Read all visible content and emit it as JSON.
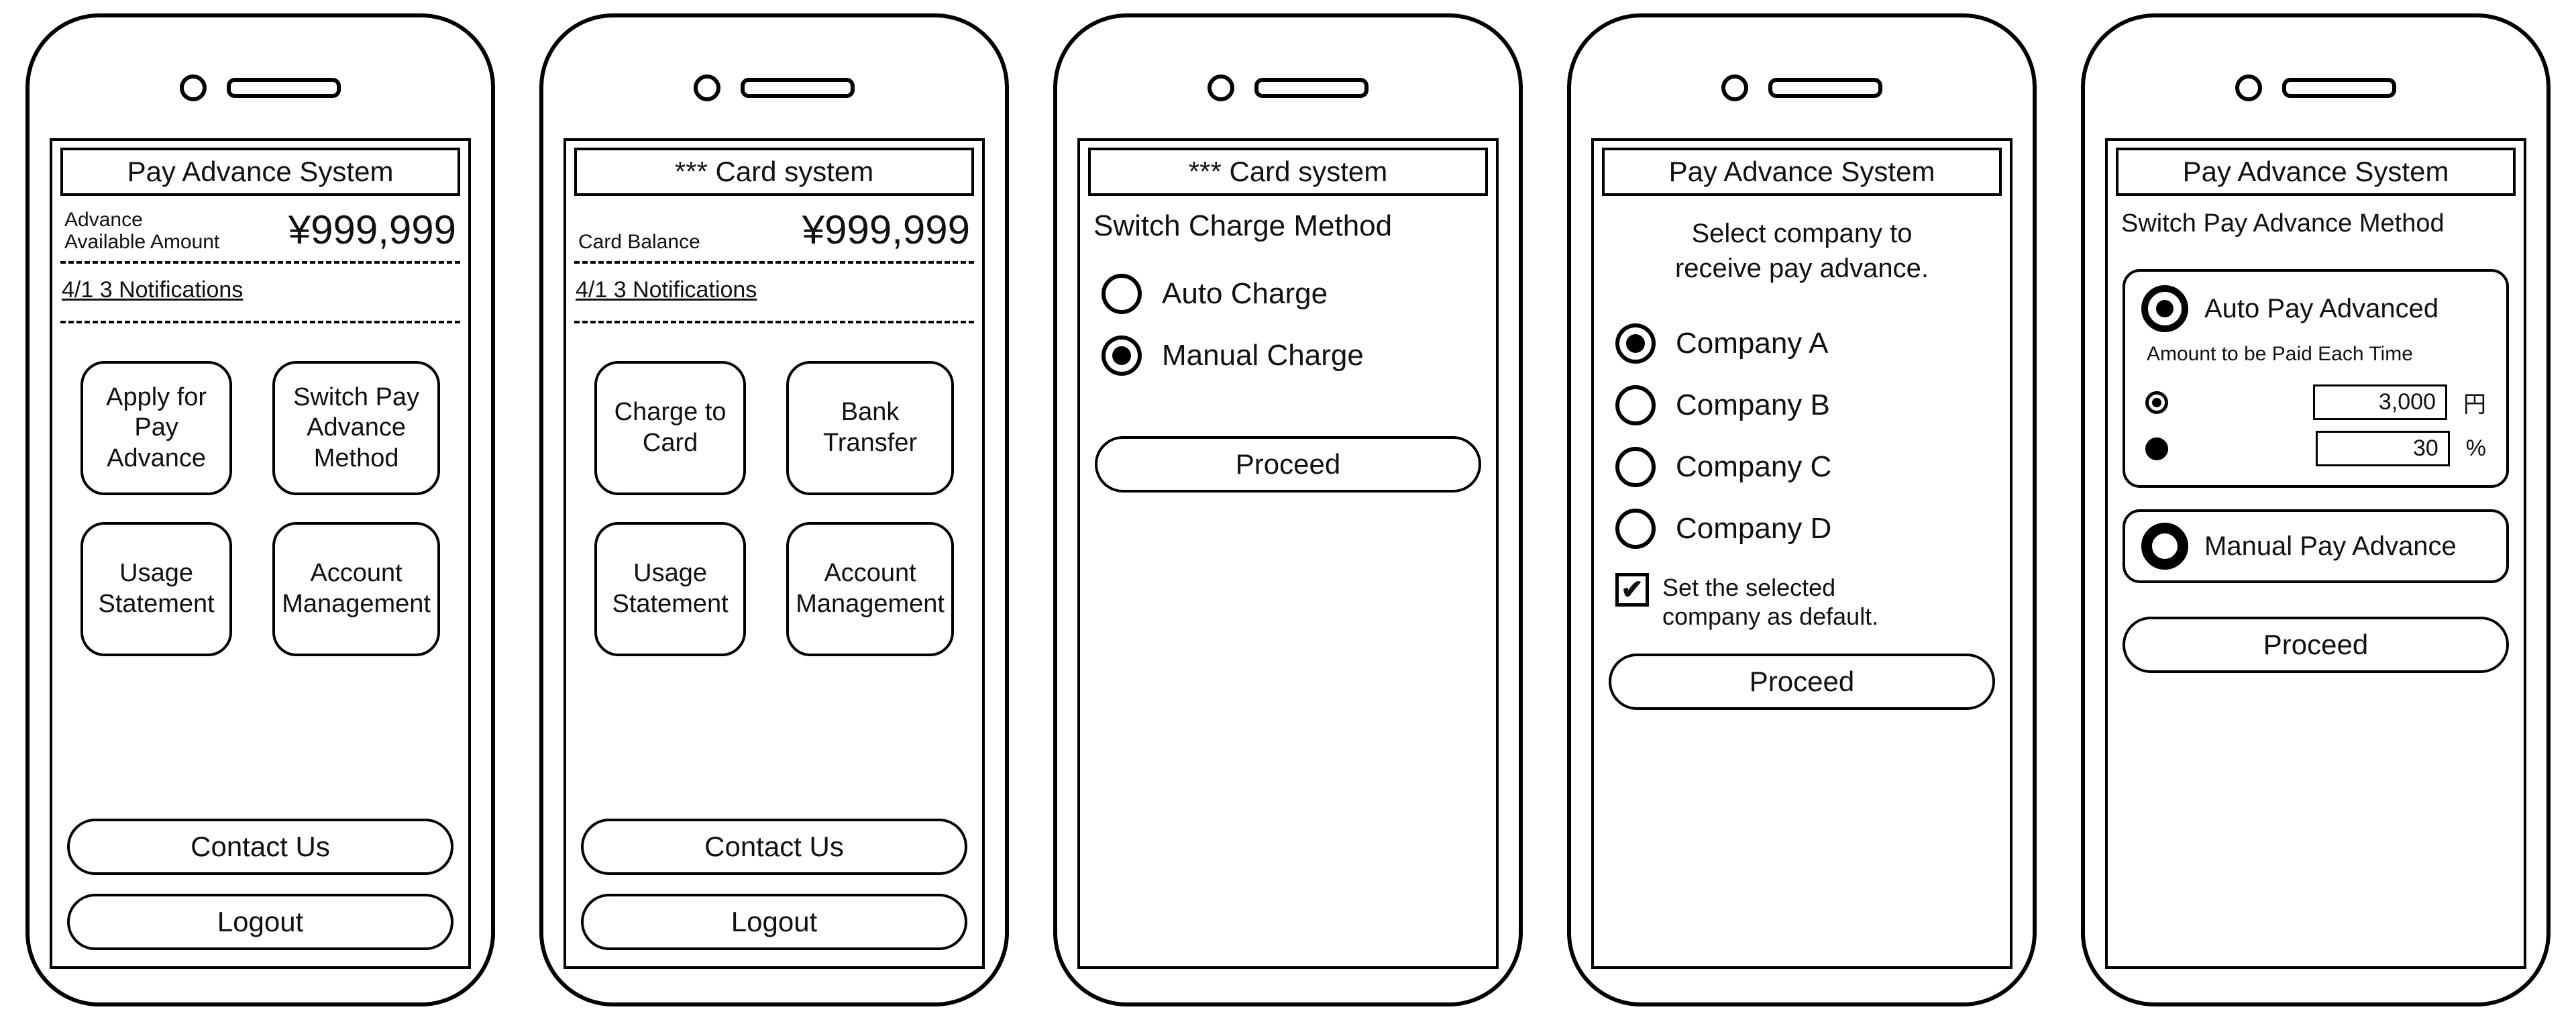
{
  "screen1": {
    "title": "Pay Advance System",
    "balance_label": "Advance\nAvailable Amount",
    "balance_amount": "¥999,999",
    "notifications": "4/1  3 Notifications",
    "tiles": {
      "apply": "Apply for\nPay Advance",
      "switch": "Switch Pay\nAdvance\nMethod",
      "usage": "Usage\nStatement",
      "account": "Account\nManagement"
    },
    "contact": "Contact Us",
    "logout": "Logout"
  },
  "screen2": {
    "title": "*** Card system",
    "balance_label": "Card Balance",
    "balance_amount": "¥999,999",
    "notifications": "4/1  3 Notifications",
    "tiles": {
      "charge": "Charge to\nCard",
      "bank": "Bank\nTransfer",
      "usage": "Usage\nStatement",
      "account": "Account\nManagement"
    },
    "contact": "Contact Us",
    "logout": "Logout"
  },
  "screen3": {
    "title": "*** Card system",
    "subtitle": "Switch Charge Method",
    "options": {
      "auto": "Auto Charge",
      "manual": "Manual Charge"
    },
    "selected": "manual",
    "proceed": "Proceed"
  },
  "screen4": {
    "title": "Pay Advance System",
    "subtitle": "Select company to\nreceive pay advance.",
    "companies": [
      "Company A",
      "Company B",
      "Company C",
      "Company D"
    ],
    "selected_index": 0,
    "default_checkbox": {
      "label": "Set the selected\ncompany as default.",
      "checked": true
    },
    "proceed": "Proceed"
  },
  "screen5": {
    "title": "Pay Advance System",
    "subtitle": "Switch Pay Advance Method",
    "auto": {
      "label": "Auto Pay Advanced",
      "note": "Amount to be Paid Each Time",
      "fixed_value": "3,000",
      "fixed_unit": "円",
      "percent_value": "30",
      "percent_unit": "%",
      "selected_sub": "fixed"
    },
    "manual": {
      "label": "Manual Pay Advance"
    },
    "selected": "auto",
    "proceed": "Proceed"
  }
}
